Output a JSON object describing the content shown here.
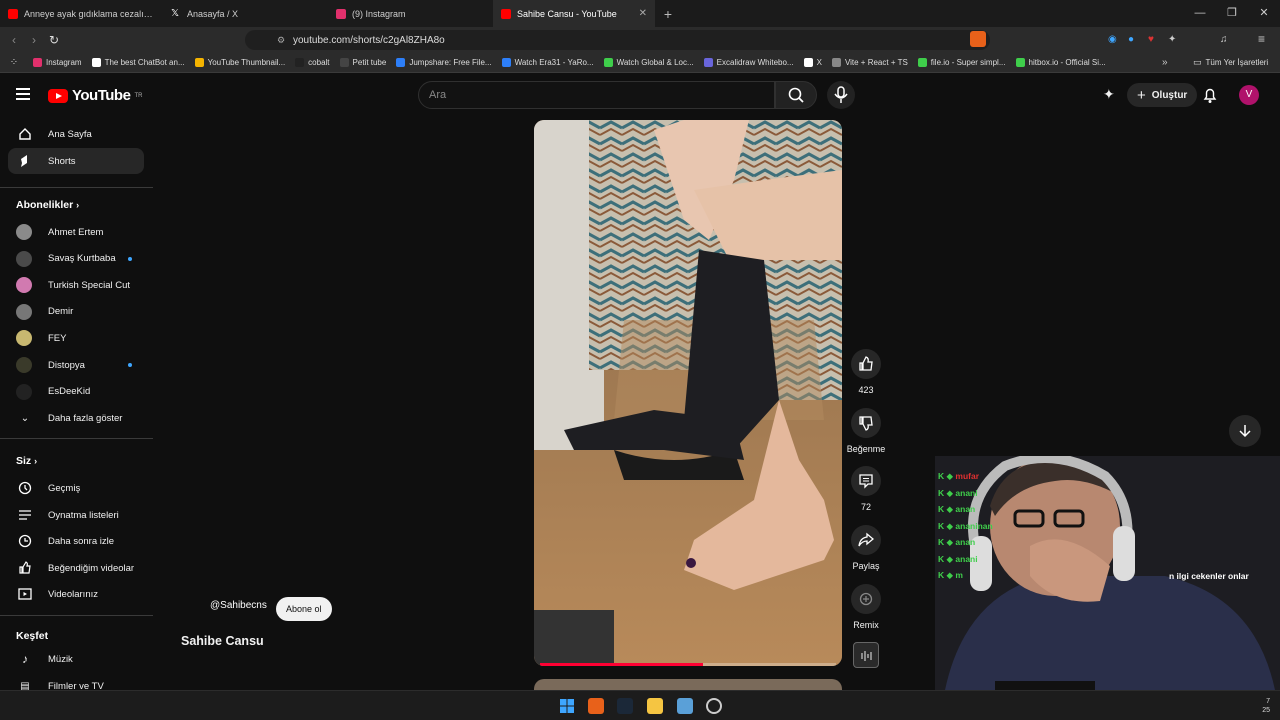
{
  "browser": {
    "tabs": [
      {
        "title": "Anneye ayak gıdıklama cezalı /tickle",
        "color": "#ff0000",
        "active": false
      },
      {
        "title": "Anasayfa / X",
        "color": "#ffffff",
        "active": false
      },
      {
        "title": "(9) Instagram",
        "color": "#e1306c",
        "active": false
      },
      {
        "title": "Sahibe Cansu - YouTube",
        "color": "#ff0000",
        "active": true
      }
    ],
    "new_tab": "+",
    "url": "youtube.com/shorts/c2gAl8ZHA8o",
    "bookmarks": [
      {
        "label": "Instagram",
        "color": "#e1306c"
      },
      {
        "label": "The best ChatBot an...",
        "color": "#ffffff"
      },
      {
        "label": "YouTube Thumbnail...",
        "color": "#f5b400"
      },
      {
        "label": "cobalt",
        "color": "#222222"
      },
      {
        "label": "Petit tube",
        "color": "#444444"
      },
      {
        "label": "Jumpshare: Free File...",
        "color": "#2d7ff9"
      },
      {
        "label": "Watch Era31 - YaRo...",
        "color": "#2d7ff9"
      },
      {
        "label": "Watch Global & Loc...",
        "color": "#3fce4b"
      },
      {
        "label": "Excalidraw Whitebo...",
        "color": "#6965db"
      },
      {
        "label": "X",
        "color": "#ffffff"
      },
      {
        "label": "Vite + React + TS",
        "color": "#888888"
      },
      {
        "label": "file.io - Super simpl...",
        "color": "#3fce4b"
      },
      {
        "label": "hitbox.io - Official Si...",
        "color": "#3fce4b"
      }
    ],
    "more_bookmarks": "»",
    "all_bookmarks": "Tüm Yer İşaretleri"
  },
  "yt": {
    "logo": "YouTube",
    "logo_sup": "TR",
    "search_placeholder": "Ara",
    "create": "Oluştur",
    "avatar": "V"
  },
  "sidebar": {
    "main": [
      {
        "label": "Ana Sayfa"
      },
      {
        "label": "Shorts"
      }
    ],
    "subs_header": "Abonelikler",
    "subs": [
      {
        "label": "Ahmet Ertem",
        "color": "#8a8a8a",
        "dot": false
      },
      {
        "label": "Savaş Kurtbaba",
        "color": "#4a4a4a",
        "dot": true
      },
      {
        "label": "Turkish Special Cut",
        "color": "#d17ab0",
        "dot": false
      },
      {
        "label": "Demir",
        "color": "#777777",
        "dot": false
      },
      {
        "label": "FEY",
        "color": "#c8b870",
        "dot": false
      },
      {
        "label": "Distopya",
        "color": "#3a3a2a",
        "dot": true
      },
      {
        "label": "EsDeeKid",
        "color": "#222222",
        "dot": false
      }
    ],
    "show_more": "Daha fazla göster",
    "you_header": "Siz",
    "you": [
      {
        "label": "Geçmiş"
      },
      {
        "label": "Oynatma listeleri"
      },
      {
        "label": "Daha sonra izle"
      },
      {
        "label": "Beğendiğim videolar"
      },
      {
        "label": "Videolarınız"
      }
    ],
    "explore_header": "Keşfet",
    "explore": [
      {
        "label": "Müzik"
      },
      {
        "label": "Filmler ve TV"
      }
    ]
  },
  "short": {
    "channel": "@Sahibecns",
    "subscribe": "Abone ol",
    "title": "Sahibe Cansu",
    "like_count": "423",
    "dislike": "Beğenme",
    "comments": "72",
    "share": "Paylaş",
    "remix": "Remix",
    "progress": 0.55
  },
  "overlay": {
    "chat": [
      {
        "user": "mufar",
        "text": ""
      },
      {
        "user": "anani",
        "text": ""
      },
      {
        "user": "anan",
        "text": ""
      },
      {
        "user": "ananinan",
        "text": ""
      },
      {
        "user": "anan",
        "text": ""
      },
      {
        "user": "anani",
        "text": ""
      },
      {
        "user": "m",
        "text": ""
      }
    ],
    "caption": "n ilgi cekenler onlar"
  },
  "clock": {
    "line1": "7",
    "line2": "25"
  }
}
